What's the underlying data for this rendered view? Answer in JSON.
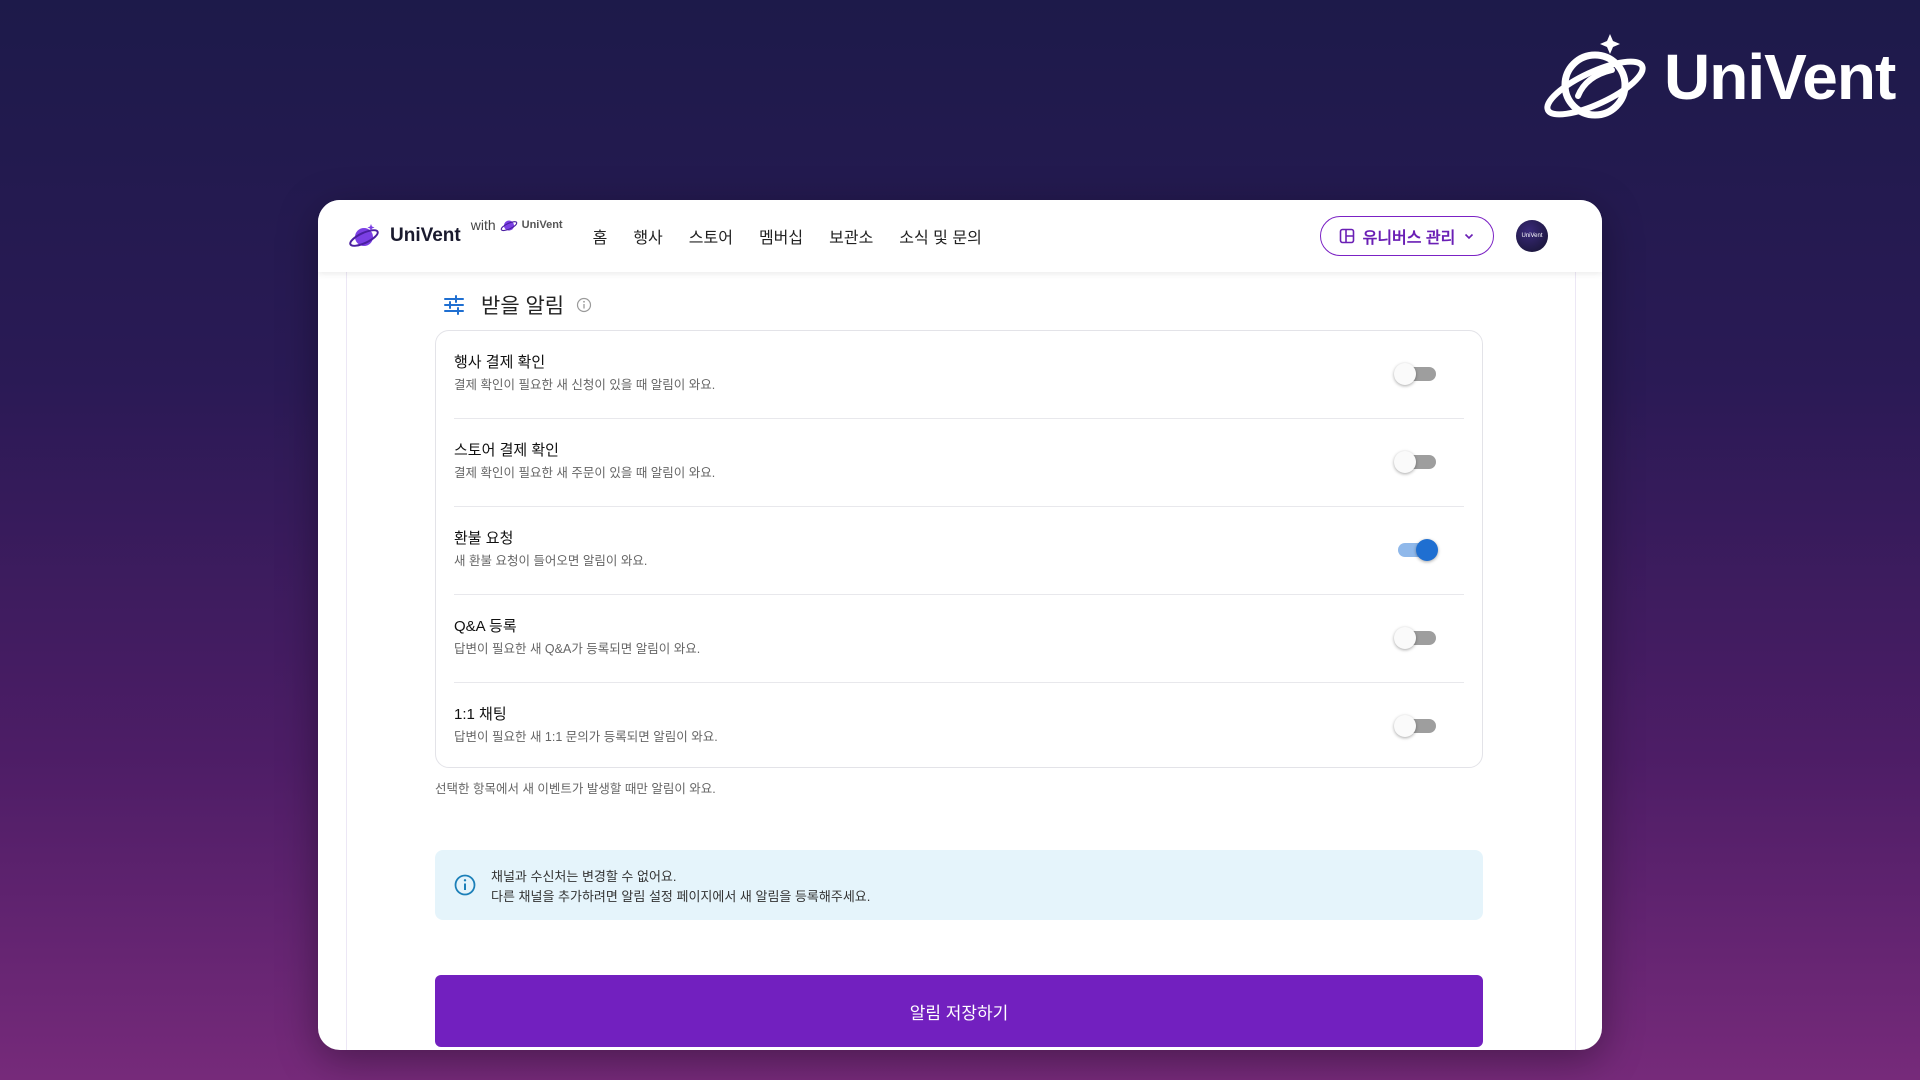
{
  "brand": {
    "name": "UniVent"
  },
  "header": {
    "logo_text": "UniVent",
    "with_label": "with",
    "with_brand": "UniVent",
    "nav": [
      "홈",
      "행사",
      "스토어",
      "멤버십",
      "보관소",
      "소식 및 문의"
    ],
    "universe_button": "유니버스 관리",
    "avatar_text": "UniVent"
  },
  "section": {
    "title": "받을 알림"
  },
  "notifications": [
    {
      "label": "행사 결제 확인",
      "desc": "결제 확인이 필요한 새 신청이 있을 때 알림이 와요.",
      "enabled": false
    },
    {
      "label": "스토어 결제 확인",
      "desc": "결제 확인이 필요한 새 주문이 있을 때 알림이 와요.",
      "enabled": false
    },
    {
      "label": "환불 요청",
      "desc": "새 환불 요청이 들어오면 알림이 와요.",
      "enabled": true
    },
    {
      "label": "Q&A 등록",
      "desc": "답변이 필요한 새 Q&A가 등록되면 알림이 와요.",
      "enabled": false
    },
    {
      "label": "1:1 채팅",
      "desc": "답변이 필요한 새 1:1 문의가 등록되면 알림이 와요.",
      "enabled": false
    }
  ],
  "hint": "선택한 항목에서 새 이벤트가 발생할 때만 알림이 와요.",
  "notice": {
    "line1": "채널과 수신처는 변경할 수 없어요.",
    "line2": "다른 채널을 추가하려면 알림 설정 페이지에서 새 알림을 등록해주세요."
  },
  "save_button": "알림 저장하기",
  "colors": {
    "accent": "#7220bf",
    "toggle_on": "#1f6fd1",
    "notice_bg": "#e5f4fb"
  }
}
